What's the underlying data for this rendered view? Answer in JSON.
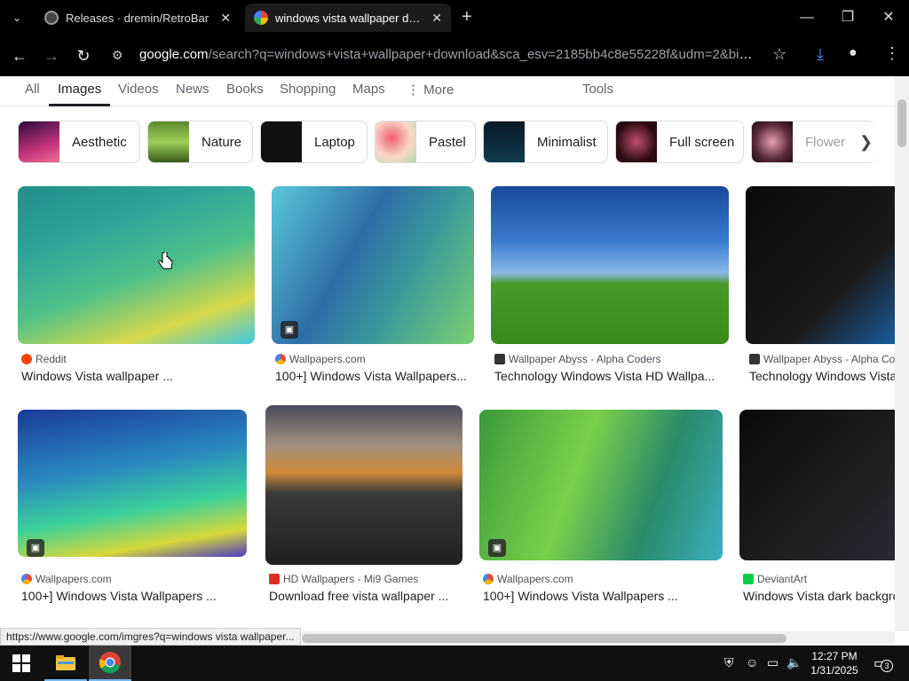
{
  "browser": {
    "tabs": [
      {
        "title": "Releases · dremin/RetroBar",
        "close": "✕"
      },
      {
        "title": "windows vista wallpaper download",
        "close": "✕"
      }
    ],
    "new_tab": "+",
    "window_controls": {
      "minimize": "—",
      "maximize": "❐",
      "close": "✕"
    },
    "address": {
      "host": "google.com",
      "path": "/search?q=windows+vista+wallpaper+download&sca_esv=2185bb4c8e55228f&udm=2&biw=1024..."
    }
  },
  "google": {
    "tabs": [
      "All",
      "Images",
      "Videos",
      "News",
      "Books",
      "Shopping",
      "Maps",
      "More",
      "Tools"
    ],
    "active_tab": "Images",
    "chips": [
      "Aesthetic",
      "Nature",
      "Laptop",
      "Pastel",
      "Minimalist",
      "Full screen",
      "Flower"
    ]
  },
  "results": [
    {
      "source": "Reddit",
      "caption": "Windows Vista wallpaper ...",
      "icon_color": "#ff4500"
    },
    {
      "source": "Wallpapers.com",
      "caption": "100+] Windows Vista Wallpapers...",
      "icon_color": "#e8473e"
    },
    {
      "source": "Wallpaper Abyss - Alpha Coders",
      "caption": "Technology Windows Vista HD Wallpa...",
      "icon_color": "#333333"
    },
    {
      "source": "Wallpaper Abyss - Alpha Coders",
      "caption": "Technology Windows Vista HD Wallpaper",
      "icon_color": "#333333"
    },
    {
      "source": "Wallpapers.com",
      "caption": "100+] Windows Vista Wallpapers ...",
      "icon_color": "#e8473e"
    },
    {
      "source": "HD Wallpapers - Mi9 Games",
      "caption": "Download free vista wallpaper ...",
      "icon_color": "#d93025"
    },
    {
      "source": "Wallpapers.com",
      "caption": "100+] Windows Vista Wallpapers ...",
      "icon_color": "#e8473e"
    },
    {
      "source": "DeviantArt",
      "caption": "Windows Vista dark background",
      "icon_color": "#05cc47"
    }
  ],
  "status_url": "https://www.google.com/imgres?q=windows vista wallpaper...",
  "taskbar": {
    "time": "12:27 PM",
    "date": "1/31/2025",
    "notification_count": "3"
  }
}
